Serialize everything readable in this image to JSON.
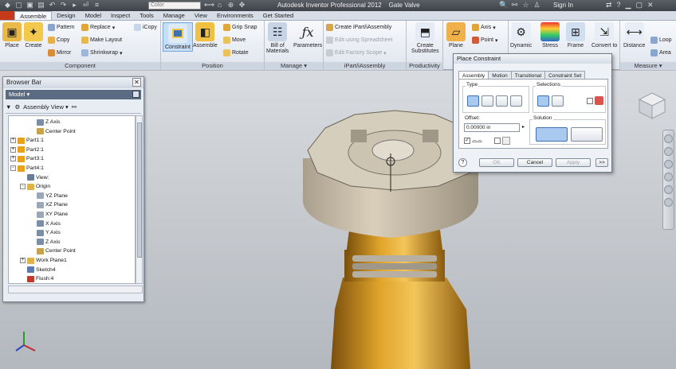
{
  "titlebar": {
    "combo_value": "Color",
    "title": "Autodesk Inventor Professional 2012",
    "document": "Gate Valve",
    "signin": "Sign In"
  },
  "tabs": [
    "Assemble",
    "Design",
    "Model",
    "Inspect",
    "Tools",
    "Manage",
    "View",
    "Environments",
    "Get Started"
  ],
  "ribbon": {
    "component": {
      "title": "Component",
      "place": "Place",
      "create": "Create",
      "pattern": "Pattern",
      "copy": "Copy",
      "mirror": "Mirror",
      "replace": "Replace",
      "make_layout": "Make Layout",
      "shrinkwrap": "Shrinkwrap",
      "icopy": "iCopy"
    },
    "position": {
      "title": "Position",
      "constraint": "Constraint",
      "assemble": "Assemble",
      "grip_snap": "Grip Snap",
      "move": "Move",
      "rotate": "Rotate"
    },
    "manage": {
      "title": "Manage",
      "bill_line1": "Bill of",
      "bill_line2": "Materials",
      "parameters": "Parameters"
    },
    "ipart": {
      "title": "iPart/iAssembly",
      "create": "Create iPart/iAssembly",
      "edit_spreadsheet": "Edit using Spreadsheet",
      "edit_factory": "Edit Factory Scope"
    },
    "productivity": {
      "title": "Productivity",
      "create": "Create",
      "substitutes": "Substitutes"
    },
    "work": {
      "plane": "Plane",
      "axis": "Axis",
      "point": "Point"
    },
    "simulation": {
      "dynamic": "Dynamic",
      "stress": "Stress",
      "frame": "Frame",
      "convert": "Convert to"
    },
    "measure": {
      "title": "Measure",
      "distance": "Distance",
      "loop": "Loop",
      "area": "Area"
    }
  },
  "browser": {
    "title": "Browser Bar",
    "model": "Model",
    "view_mode": "Assembly View",
    "tree": [
      {
        "label": "Z Axis",
        "indent": 2,
        "icon": "axis-icon",
        "color": "#7a8ea8"
      },
      {
        "label": "Center Point",
        "indent": 2,
        "icon": "point-icon",
        "color": "#c9a34a"
      },
      {
        "label": "Part1:1",
        "indent": 0,
        "icon": "part-icon",
        "color": "#e8a21c",
        "exp": "+"
      },
      {
        "label": "Part2:1",
        "indent": 0,
        "icon": "part-icon",
        "color": "#e8a21c",
        "exp": "+"
      },
      {
        "label": "Part3:1",
        "indent": 0,
        "icon": "part-icon",
        "color": "#e8a21c",
        "exp": "+"
      },
      {
        "label": "Part4:1",
        "indent": 0,
        "icon": "part-icon",
        "color": "#e8a21c",
        "exp": "-"
      },
      {
        "label": "View:",
        "indent": 1,
        "icon": "view-icon",
        "color": "#6a7d96"
      },
      {
        "label": "Origin",
        "indent": 1,
        "icon": "folder-icon",
        "color": "#e0b24a",
        "exp": "-"
      },
      {
        "label": "YZ Plane",
        "indent": 2,
        "icon": "plane-icon",
        "color": "#9aa7b8"
      },
      {
        "label": "XZ Plane",
        "indent": 2,
        "icon": "plane-icon",
        "color": "#9aa7b8"
      },
      {
        "label": "XY Plane",
        "indent": 2,
        "icon": "plane-icon",
        "color": "#9aa7b8"
      },
      {
        "label": "X Axis",
        "indent": 2,
        "icon": "axis-icon",
        "color": "#7a8ea8"
      },
      {
        "label": "Y Axis",
        "indent": 2,
        "icon": "axis-icon",
        "color": "#7a8ea8"
      },
      {
        "label": "Z Axis",
        "indent": 2,
        "icon": "axis-icon",
        "color": "#7a8ea8"
      },
      {
        "label": "Center Point",
        "indent": 2,
        "icon": "point-icon",
        "color": "#c9a34a"
      },
      {
        "label": "Work Plane1",
        "indent": 1,
        "icon": "plane-icon",
        "color": "#e0b24a",
        "exp": "+"
      },
      {
        "label": "Sketch4",
        "indent": 1,
        "icon": "sketch-icon",
        "color": "#5a7ab0"
      },
      {
        "label": "Flush:4",
        "indent": 1,
        "icon": "constraint-icon",
        "color": "#c0392b"
      }
    ]
  },
  "dialog": {
    "title": "Place Constraint",
    "tabs": [
      "Assembly",
      "Motion",
      "Transitional",
      "Constraint Set"
    ],
    "type_label": "Type",
    "selections_label": "Selections",
    "offset_label": "Offset:",
    "offset_value": "0.00000 in",
    "solution_label": "Solution",
    "ok": "OK",
    "cancel": "Cancel",
    "apply": "Apply",
    "more": ">>"
  },
  "colors": {
    "accent": "#c63a1a",
    "part_gold": "#d19a22",
    "knob": "#d2c8b4"
  }
}
